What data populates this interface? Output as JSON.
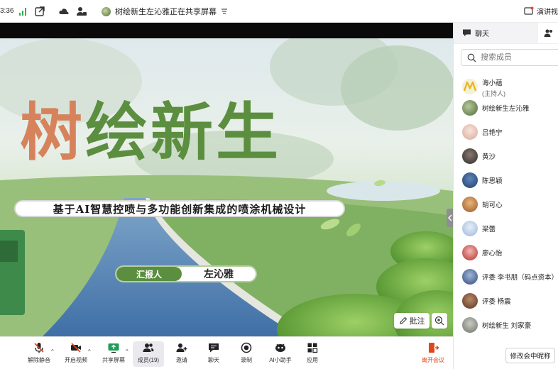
{
  "status_bar": {
    "time": "3:36",
    "share_title": "树绘新生左沁雅正在共享屏幕",
    "present_label": "演讲视"
  },
  "slide": {
    "title_part1": "树",
    "title_part2": "绘新生",
    "subtitle": "基于AI智慧控喷与多功能创新集成的喷涂机械设计",
    "reporter_label": "汇报人",
    "reporter_name": "左沁雅"
  },
  "overlay": {
    "annotate_label": "批注"
  },
  "toolbar": {
    "unmute": "解除静音",
    "video": "开启视频",
    "share": "共享屏幕",
    "members": "成员(19)",
    "invite": "邀请",
    "chat": "聊天",
    "record": "录制",
    "ai_assistant": "AI小助手",
    "apps": "应用",
    "leave": "离开会议"
  },
  "panel": {
    "tab_chat": "聊天",
    "search_placeholder": "搜索成员",
    "members": [
      {
        "name": "海小蕴",
        "sub": "(主持人)",
        "avatar": "#f2c230"
      },
      {
        "name": "树绘新生左沁雅",
        "sub": "",
        "avatar": "#6f8a55"
      },
      {
        "name": "吕艳宁",
        "sub": "",
        "avatar": "#e9c7b8"
      },
      {
        "name": "黄沙",
        "sub": "",
        "avatar": "#3a3a3a"
      },
      {
        "name": "陈思颖",
        "sub": "",
        "avatar": "#2f5f9c"
      },
      {
        "name": "胡可心",
        "sub": "",
        "avatar": "#d08a4a"
      },
      {
        "name": "梁蕾",
        "sub": "",
        "avatar": "#a8c6e8"
      },
      {
        "name": "廖心怡",
        "sub": "",
        "avatar": "#c23a3a"
      },
      {
        "name": "评委 李书朋（码点资本）",
        "sub": "",
        "avatar": "#3c5b8c"
      },
      {
        "name": "评委 杨震",
        "sub": "",
        "avatar": "#7a4b2e"
      },
      {
        "name": "树绘新生 刘家豪",
        "sub": "",
        "avatar": "#8a8f86"
      }
    ],
    "rename_button": "修改会中昵称"
  }
}
